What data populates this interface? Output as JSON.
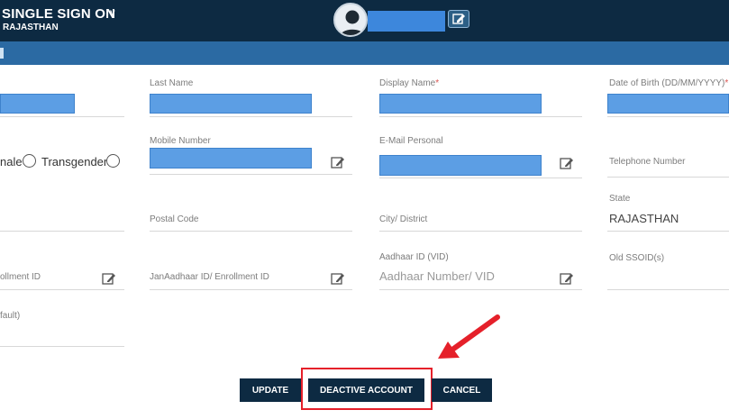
{
  "header": {
    "title": "SINGLE SIGN ON",
    "caret": "v",
    "subtitle": "RAJASTHAN"
  },
  "form": {
    "last_name_label": "Last Name",
    "display_name_label": "Display Name",
    "dob_label": "Date of Birth (DD/MM/YYYY)",
    "required_mark": "*",
    "gender_female_partial": "nale",
    "gender_transgender": "Transgender",
    "mobile_label": "Mobile Number",
    "email_label": "E-Mail Personal",
    "telephone_label": "Telephone Number",
    "state_label": "State",
    "state_value": "RAJASTHAN",
    "postal_label": "Postal Code",
    "city_label": "City/ District",
    "aadhaar_label": "Aadhaar ID (VID)",
    "aadhaar_placeholder": "Aadhaar Number/ VID",
    "old_ssoid_label": "Old SSOID(s)",
    "enrollment_partial_label": "ollment ID",
    "janaadhaar_label": "JanAadhaar ID/ Enrollment ID",
    "default_partial_label": "fault)"
  },
  "buttons": {
    "update": "UPDATE",
    "deactivate": "DEACTIVE ACCOUNT",
    "cancel": "CANCEL"
  },
  "annotation": {
    "highlight_color": "#e5202a"
  }
}
